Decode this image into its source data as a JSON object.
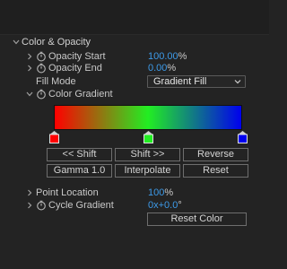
{
  "section": {
    "title": "Color & Opacity"
  },
  "properties": {
    "opacity_start": {
      "label": "Opacity Start",
      "value": "100.00",
      "unit": "%"
    },
    "opacity_end": {
      "label": "Opacity End",
      "value": "0.00",
      "unit": "%"
    },
    "fill_mode": {
      "label": "Fill Mode",
      "selected": "Gradient Fill"
    },
    "color_gradient": {
      "label": "Color Gradient",
      "stops": [
        {
          "color": "#ff0000",
          "position": 0.0
        },
        {
          "color": "#22ee22",
          "position": 0.5
        },
        {
          "color": "#0000ee",
          "position": 1.0
        }
      ]
    },
    "point_location": {
      "label": "Point Location",
      "value": "100",
      "unit": "%"
    },
    "cycle_gradient": {
      "label": "Cycle Gradient",
      "value": "0x+0.0",
      "unit": "°"
    }
  },
  "buttons": {
    "shift_left": "<< Shift",
    "shift_right": "Shift >>",
    "reverse": "Reverse",
    "gamma": "Gamma 1.0",
    "interpolate": "Interpolate",
    "reset": "Reset",
    "reset_color": "Reset Color"
  },
  "colors": {
    "accent_value": "#3d9ae8",
    "background": "#232323",
    "text": "#c8c8c8"
  },
  "icons": {
    "expand": "chevron-down-icon",
    "collapse": "chevron-right-icon",
    "animate": "stopwatch-icon"
  }
}
